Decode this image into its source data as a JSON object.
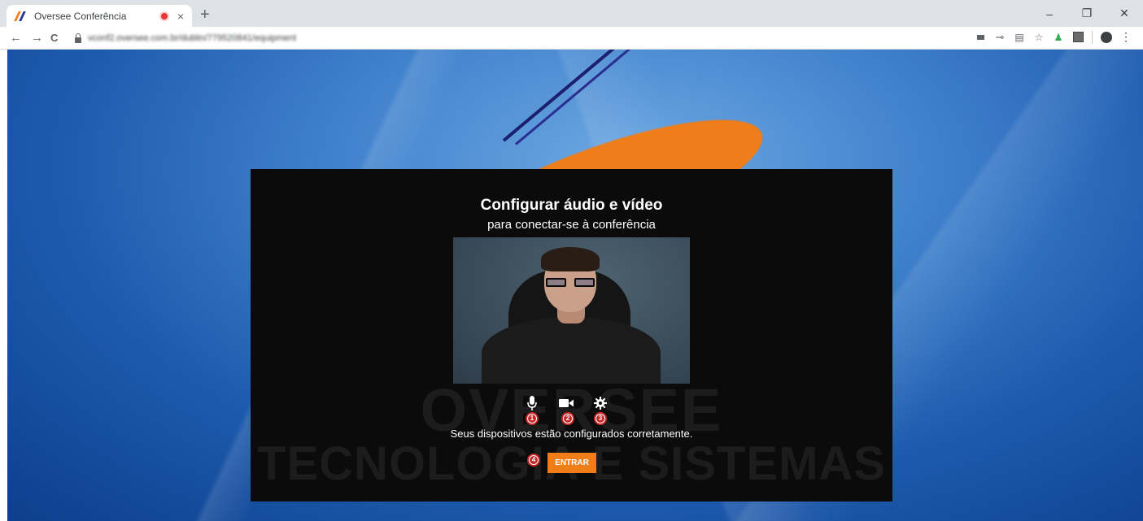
{
  "browser": {
    "tab": {
      "title": "Oversee Conferência",
      "close": "×"
    },
    "new_tab": "+",
    "window": {
      "minimize": "–",
      "restore": "❐",
      "close": "✕"
    },
    "nav": {
      "back": "←",
      "forward": "→",
      "reload": "C"
    },
    "url": "vconf2.oversee.com.br/dublin/779520841/equipment",
    "menu": "⋮"
  },
  "page": {
    "heading": "Configurar áudio e vídeo",
    "subheading": "para conectar-se à conferência",
    "watermark": {
      "line1": "OVERSEE",
      "line2": "TECNOLOGIA E SISTEMAS"
    },
    "controls": {
      "mic_icon": "microphone-icon",
      "camera_icon": "video-camera-icon",
      "settings_icon": "gear-icon"
    },
    "badges": [
      "1",
      "2",
      "3",
      "4"
    ],
    "status": "Seus dispositivos estão configurados corretamente.",
    "enter_button": "ENTRAR",
    "colors": {
      "accent": "#ef7d1a",
      "badge": "#c62828",
      "panel": "#0b0b0b"
    }
  }
}
